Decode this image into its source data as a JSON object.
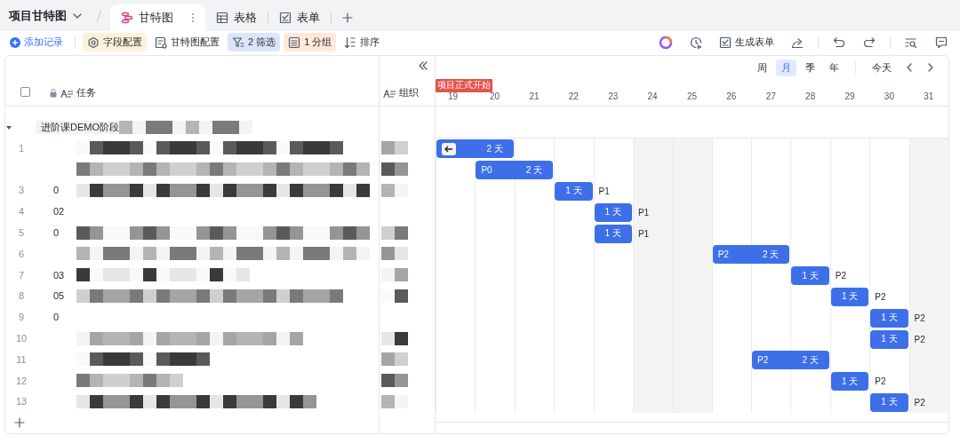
{
  "header": {
    "title": "项目甘特图",
    "tabs": [
      {
        "label": "甘特图",
        "kind": "gantt",
        "selected": true
      },
      {
        "label": "表格",
        "kind": "grid",
        "selected": false
      },
      {
        "label": "表单",
        "kind": "form",
        "selected": false
      }
    ]
  },
  "toolbar": {
    "left": [
      {
        "label": "添加记录",
        "kind": "add",
        "active": false
      },
      {
        "label": "字段配置",
        "kind": "field",
        "active": true,
        "color": "#fcf2da"
      },
      {
        "label": "甘特图配置",
        "kind": "gantt-config",
        "active": false
      },
      {
        "label": "2 筛选",
        "kind": "filter",
        "active": true,
        "color": "#dce5fb"
      },
      {
        "label": "1 分组",
        "kind": "group",
        "active": true,
        "color": "#fde8da"
      },
      {
        "label": "排序",
        "kind": "sort",
        "active": false
      }
    ],
    "right": [
      {
        "kind": "ai"
      },
      {
        "kind": "history"
      },
      {
        "kind": "form",
        "label": "生成表单"
      },
      {
        "kind": "share"
      },
      {
        "kind": "undo"
      },
      {
        "kind": "redo"
      },
      {
        "kind": "find"
      },
      {
        "kind": "comment"
      }
    ]
  },
  "table": {
    "select_all": {
      "checked": false
    },
    "columns": [
      {
        "label": "任务",
        "locked": true
      },
      {
        "label": "组织",
        "locked": false
      }
    ],
    "group": {
      "label": "进阶课DEMO阶段",
      "expanded": true
    },
    "rows": [
      {
        "number": "1"
      },
      {},
      {
        "number": "3",
        "id_prefix": "0"
      },
      {
        "number": "4",
        "id_prefix": "02"
      },
      {
        "number": "5",
        "id_prefix": "0"
      },
      {
        "number": "6"
      },
      {
        "number": "7",
        "id_prefix": "03"
      },
      {
        "number": "8",
        "id_prefix": "05"
      },
      {
        "number": "9",
        "id_prefix": "0"
      },
      {
        "number": "10"
      },
      {
        "number": "11"
      },
      {
        "number": "12"
      },
      {
        "number": "13"
      }
    ]
  },
  "timeline": {
    "scales": [
      {
        "label": "周",
        "selected": false
      },
      {
        "label": "月",
        "selected": true
      },
      {
        "label": "季",
        "selected": false
      },
      {
        "label": "年",
        "selected": false
      }
    ],
    "today": "今天",
    "days": [
      {
        "label": "19",
        "weekend": false,
        "milestone": "项目正式开始"
      },
      {
        "label": "20",
        "weekend": false
      },
      {
        "label": "21",
        "weekend": false
      },
      {
        "label": "22",
        "weekend": false
      },
      {
        "label": "23",
        "weekend": false
      },
      {
        "label": "24",
        "weekend": true
      },
      {
        "label": "25",
        "weekend": true
      },
      {
        "label": "26",
        "weekend": false
      },
      {
        "label": "27",
        "weekend": false
      },
      {
        "label": "28",
        "weekend": false
      },
      {
        "label": "29",
        "weekend": false
      },
      {
        "label": "30",
        "weekend": false
      },
      {
        "label": "31",
        "weekend": true
      }
    ],
    "bars": [
      {
        "span": [
          true,
          true,
          false,
          false,
          false,
          false,
          false,
          false,
          false,
          false,
          false,
          false,
          false
        ],
        "duration": "2 天",
        "jump_button": true
      },
      {
        "span": [
          false,
          true,
          true,
          false,
          false,
          false,
          false,
          false,
          false,
          false,
          false,
          false,
          false
        ],
        "inner_label": "P0",
        "duration": "2 天"
      },
      {
        "span": [
          false,
          false,
          false,
          true,
          false,
          false,
          false,
          false,
          false,
          false,
          false,
          false,
          false
        ],
        "duration": "1 天",
        "priority": "P1"
      },
      {
        "span": [
          false,
          false,
          false,
          false,
          true,
          false,
          false,
          false,
          false,
          false,
          false,
          false,
          false
        ],
        "duration": "1 天",
        "priority": "P1"
      },
      {
        "span": [
          false,
          false,
          false,
          false,
          true,
          false,
          false,
          false,
          false,
          false,
          false,
          false,
          false
        ],
        "duration": "1 天",
        "priority": "P1"
      },
      {
        "span": [
          false,
          false,
          false,
          false,
          false,
          false,
          false,
          true,
          true,
          false,
          false,
          false,
          false
        ],
        "inner_label": "P2",
        "duration": "2 天"
      },
      {
        "span": [
          false,
          false,
          false,
          false,
          false,
          false,
          false,
          false,
          false,
          true,
          false,
          false,
          false
        ],
        "duration": "1 天",
        "priority": "P2"
      },
      {
        "span": [
          false,
          false,
          false,
          false,
          false,
          false,
          false,
          false,
          false,
          false,
          true,
          false,
          false
        ],
        "duration": "1 天",
        "priority": "P2"
      },
      {
        "span": [
          false,
          false,
          false,
          false,
          false,
          false,
          false,
          false,
          false,
          false,
          false,
          true,
          false
        ],
        "duration": "1 天",
        "priority": "P2"
      },
      {
        "span": [
          false,
          false,
          false,
          false,
          false,
          false,
          false,
          false,
          false,
          false,
          false,
          true,
          false
        ],
        "duration": "1 天",
        "priority": "P2"
      },
      {
        "span": [
          false,
          false,
          false,
          false,
          false,
          false,
          false,
          false,
          true,
          true,
          false,
          false,
          false
        ],
        "inner_label": "P2",
        "duration": "2 天"
      },
      {
        "span": [
          false,
          false,
          false,
          false,
          false,
          false,
          false,
          false,
          false,
          false,
          true,
          false,
          false
        ],
        "duration": "1 天",
        "priority": "P2"
      },
      {
        "span": [
          false,
          false,
          false,
          false,
          false,
          false,
          false,
          false,
          false,
          false,
          false,
          true,
          false
        ],
        "duration": "1 天",
        "priority": "P2"
      }
    ]
  }
}
